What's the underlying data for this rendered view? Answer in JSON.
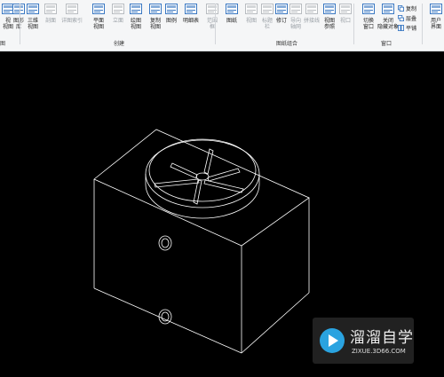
{
  "ribbon": {
    "tools": [
      {
        "label": "视\n视图",
        "icon": "default-3d-icon",
        "enabled": true
      },
      {
        "label": "图形\n库",
        "icon": "library-icon",
        "enabled": true
      },
      {
        "label": "三维\n视图",
        "icon": "3d-view-icon",
        "enabled": true
      },
      {
        "label": "剖面",
        "icon": "section-icon",
        "enabled": false
      },
      {
        "label": "详图索引",
        "icon": "detail-callout-icon",
        "enabled": false
      },
      {
        "label": "平面\n视图",
        "icon": "plan-view-icon",
        "enabled": true
      },
      {
        "label": "立面",
        "icon": "elevation-icon",
        "enabled": false
      },
      {
        "label": "绘图\n视图",
        "icon": "drafting-view-icon",
        "enabled": true
      },
      {
        "label": "复制\n视图",
        "icon": "duplicate-view-icon",
        "enabled": true
      },
      {
        "label": "图例",
        "icon": "legend-icon",
        "enabled": true
      },
      {
        "label": "明细表",
        "icon": "schedule-icon",
        "enabled": true
      },
      {
        "label": "范围\n框",
        "icon": "scope-box-icon",
        "enabled": false
      },
      {
        "label": "图纸",
        "icon": "sheet-icon",
        "enabled": true
      },
      {
        "label": "视图",
        "icon": "place-view-icon",
        "enabled": false
      },
      {
        "label": "标题\n栏",
        "icon": "title-block-icon",
        "enabled": false
      },
      {
        "label": "修订",
        "icon": "revisions-icon",
        "enabled": true
      },
      {
        "label": "导向\n轴网",
        "icon": "guide-grid-icon",
        "enabled": false
      },
      {
        "label": "拼接线",
        "icon": "matchline-icon",
        "enabled": false
      },
      {
        "label": "视图\n参照",
        "icon": "view-reference-icon",
        "enabled": true
      },
      {
        "label": "视口",
        "icon": "viewport-icon",
        "enabled": false
      },
      {
        "label": "切换\n窗口",
        "icon": "switch-windows-icon",
        "enabled": true
      },
      {
        "label": "关闭\n隐藏对象",
        "icon": "close-hidden-icon",
        "enabled": true
      },
      {
        "label": "用户\n界面",
        "icon": "user-interface-icon",
        "enabled": true
      }
    ],
    "small_tools": [
      {
        "label": "复制",
        "icon": "replicate-icon"
      },
      {
        "label": "层叠",
        "icon": "cascade-icon"
      },
      {
        "label": "平铺",
        "icon": "tile-icon"
      }
    ],
    "groups": {
      "presentation": "图",
      "create": "创建",
      "sheet_composition": "图纸组合",
      "windows": "窗口"
    }
  },
  "watermark": {
    "title": "溜溜自学",
    "url": "ZIXUE.3D66.COM"
  },
  "colors": {
    "ribbon_bg": "#f5f6f7",
    "canvas_bg": "#000000",
    "model_lines": "#ffffff",
    "icon_blue": "#3a78c2",
    "icon_disabled": "#b8bcc0"
  }
}
